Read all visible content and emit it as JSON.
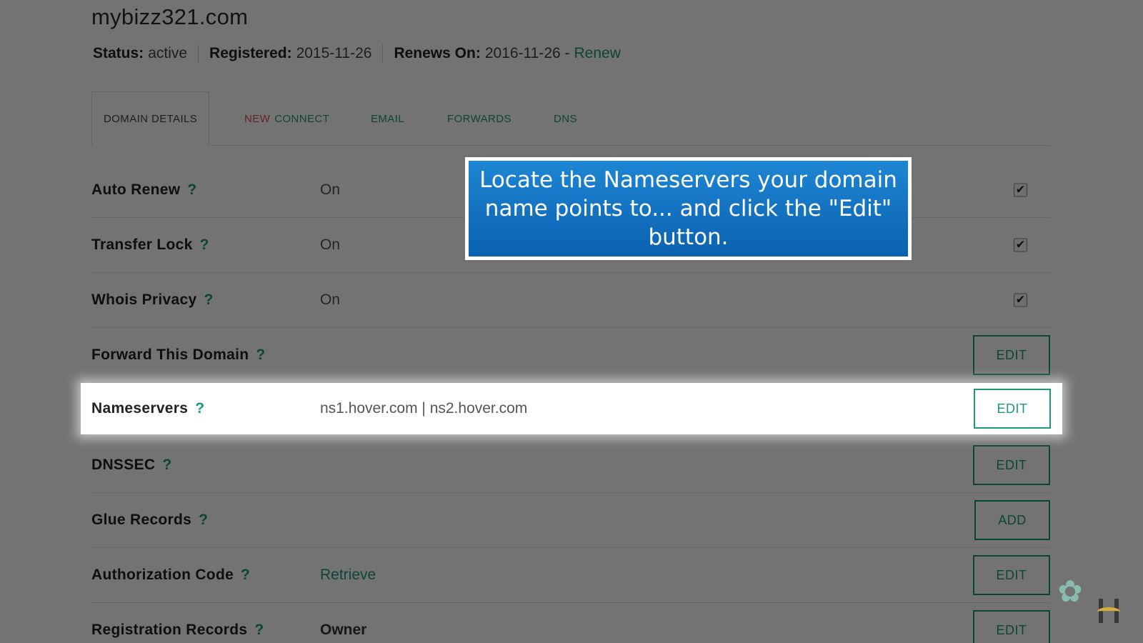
{
  "header": {
    "domain": "mybizz321.com",
    "status_label": "Status:",
    "status_value": "active",
    "registered_label": "Registered:",
    "registered_value": "2015-11-26",
    "renews_label": "Renews On:",
    "renews_value": "2016-11-26 -",
    "renew_link": "Renew"
  },
  "tabs": [
    {
      "label": "DOMAIN DETAILS"
    },
    {
      "badge": "NEW",
      "label": "CONNECT"
    },
    {
      "label": "EMAIL"
    },
    {
      "label": "FORWARDS"
    },
    {
      "label": "DNS"
    }
  ],
  "rows": [
    {
      "name": "Auto Renew",
      "help": "?",
      "value": "On",
      "checked": "✔"
    },
    {
      "name": "Transfer Lock",
      "help": "?",
      "value": "On",
      "checked": "✔"
    },
    {
      "name": "Whois Privacy",
      "help": "?",
      "value": "On",
      "checked": "✔"
    },
    {
      "name": "Forward This Domain",
      "help": "?",
      "button": "EDIT"
    },
    {
      "name": "Nameservers",
      "help": "?",
      "value": "ns1.hover.com | ns2.hover.com",
      "button": "EDIT"
    },
    {
      "name": "DNSSEC",
      "help": "?",
      "button": "EDIT"
    },
    {
      "name": "Glue Records",
      "help": "?",
      "button": "ADD"
    },
    {
      "name": "Authorization Code",
      "help": "?",
      "value": "Retrieve",
      "button": "EDIT"
    },
    {
      "name": "Registration Records",
      "help": "?",
      "value": "Owner",
      "button": "EDIT"
    }
  ],
  "callout": {
    "text": "Locate the Nameservers your domain name points to... and click the \"Edit\" button."
  },
  "colors": {
    "accent": "#1a9a7a",
    "new_badge": "#d9534f",
    "callout_blue": "#0b61b0",
    "overlay": "rgba(0,0,0,0.55)"
  },
  "icons": {
    "help": "question-icon",
    "check": "checkmark-icon",
    "watermark": "swirl-icon",
    "logo": "hover-logo-icon"
  }
}
